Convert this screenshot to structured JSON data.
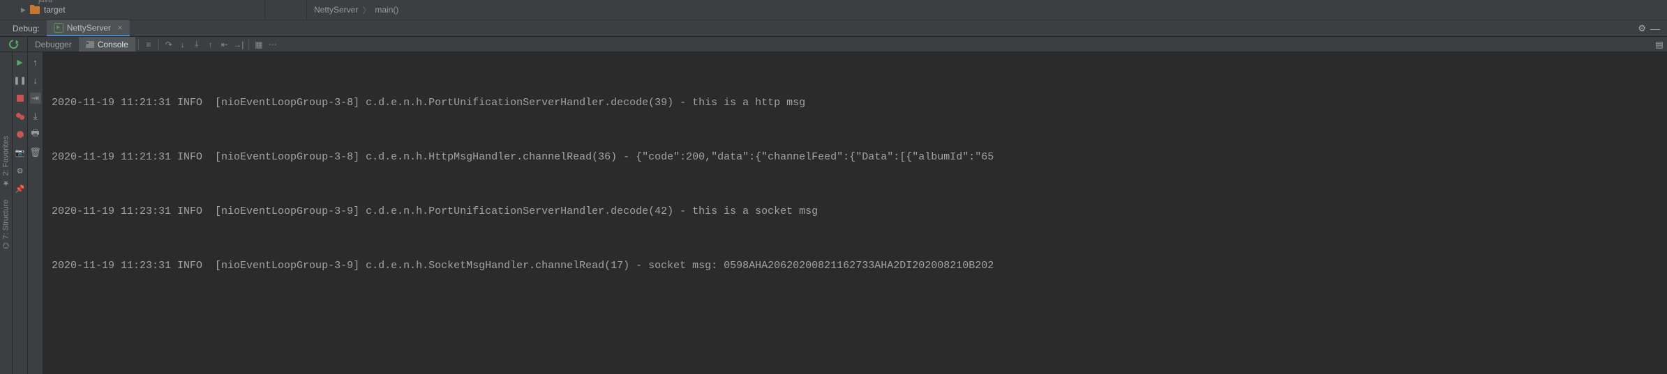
{
  "tree": {
    "prev_item": "java",
    "item": "target"
  },
  "breadcrumb": {
    "a": "NettyServer",
    "b": "main()"
  },
  "debug": {
    "label": "Debug:",
    "tab": "NettyServer"
  },
  "subtabs": {
    "debugger": "Debugger",
    "console": "Console"
  },
  "far_rail": {
    "favorites": "2: Favorites",
    "structure": "7: Structure"
  },
  "log": [
    "2020-11-19 11:21:31 INFO  [nioEventLoopGroup-3-8] c.d.e.n.h.PortUnificationServerHandler.decode(39) - this is a http msg",
    "2020-11-19 11:21:31 INFO  [nioEventLoopGroup-3-8] c.d.e.n.h.HttpMsgHandler.channelRead(36) - {\"code\":200,\"data\":{\"channelFeed\":{\"Data\":[{\"albumId\":\"65",
    "2020-11-19 11:23:31 INFO  [nioEventLoopGroup-3-9] c.d.e.n.h.PortUnificationServerHandler.decode(42) - this is a socket msg",
    "2020-11-19 11:23:31 INFO  [nioEventLoopGroup-3-9] c.d.e.n.h.SocketMsgHandler.channelRead(17) - socket msg: 0598AHA20620200821162733AHA2DI202008210B202"
  ]
}
